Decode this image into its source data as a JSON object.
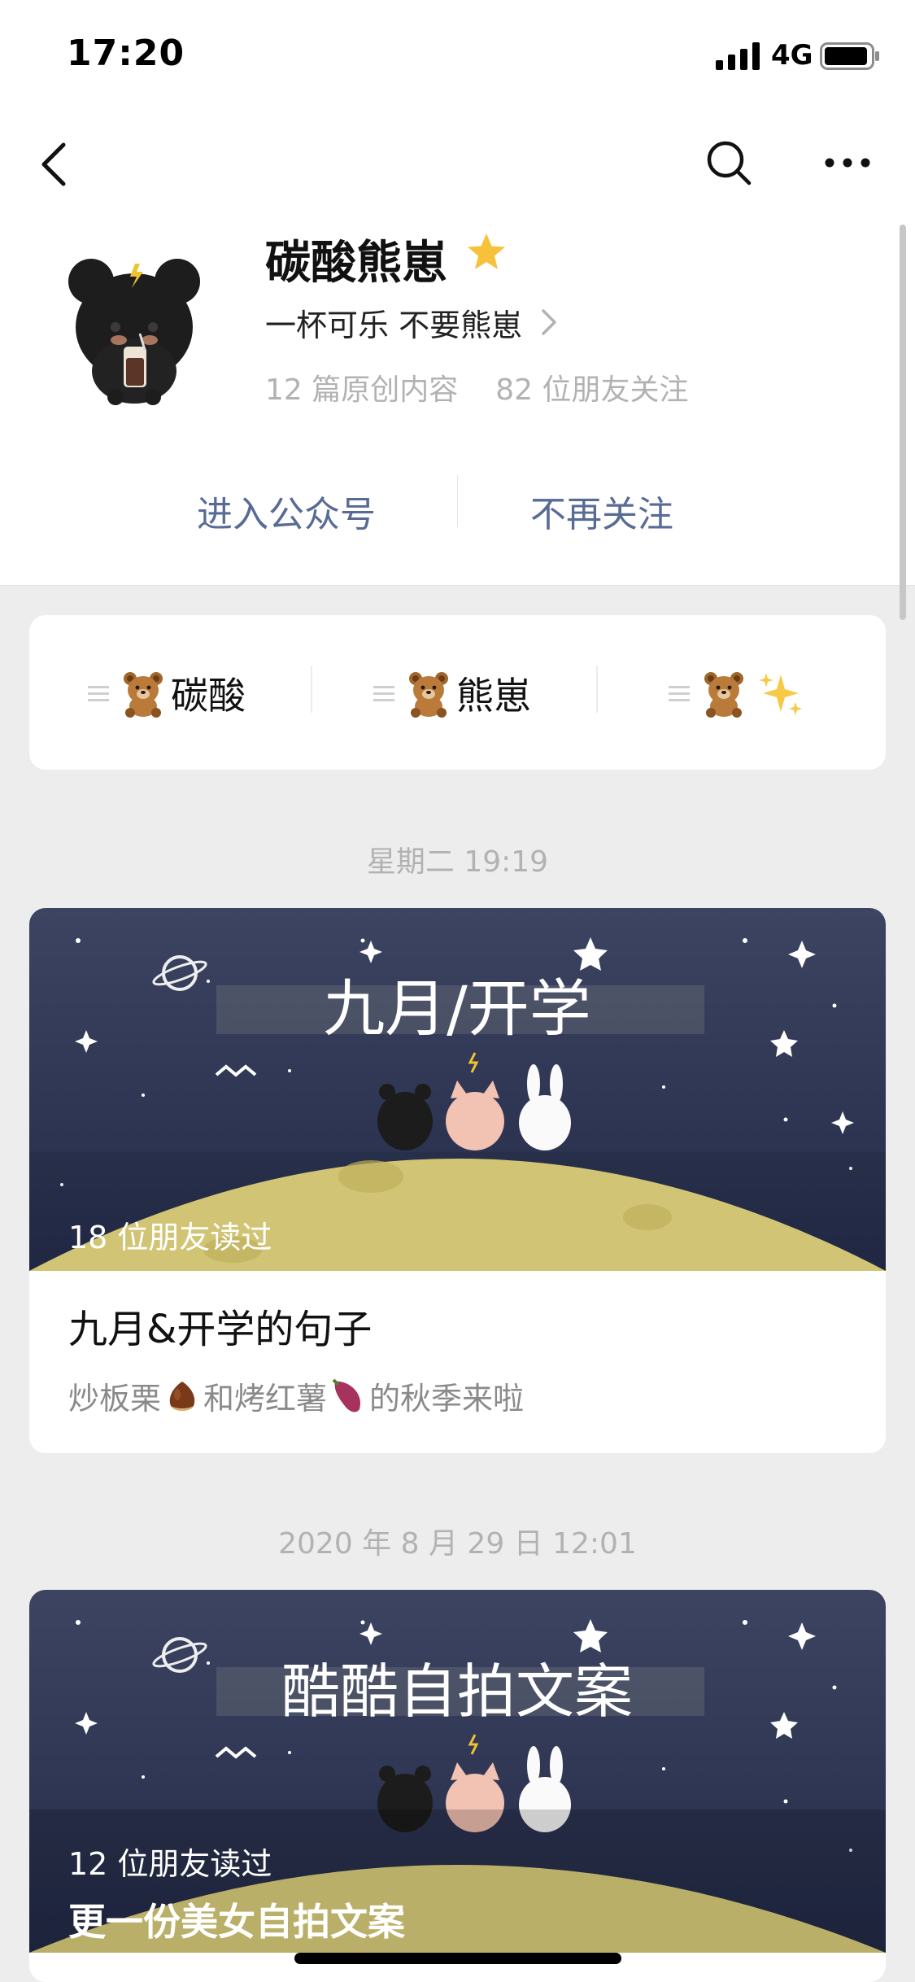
{
  "status_bar": {
    "time": "17:20",
    "network": "4G"
  },
  "nav": {
    "back": "back-icon",
    "search": "search-icon",
    "more": "more-icon"
  },
  "profile": {
    "name": "碳酸熊崽",
    "bio": "一杯可乐 不要熊崽",
    "stats": {
      "original_posts": "12 篇原创内容",
      "friends_following": "82 位朋友关注"
    },
    "actions": {
      "enter": "进入公众号",
      "unfollow": "不再关注"
    },
    "colors": {
      "link": "#576b95",
      "star": "#f7c23a"
    }
  },
  "menu": [
    {
      "label": "碳酸",
      "icon": "bear-icon"
    },
    {
      "label": "熊崽",
      "icon": "bear-icon"
    },
    {
      "label": "",
      "icon": "bear-icon",
      "extra_icon": "sparkle-icon"
    }
  ],
  "timeline": [
    {
      "date": "星期二 19:19",
      "cover_text": "九月/开学",
      "read_count": "18 位朋友读过",
      "title": "九月&开学的句子",
      "desc_parts": [
        "炒板栗",
        "和烤红薯",
        "的秋季来啦"
      ]
    },
    {
      "date": "2020 年 8 月 29 日 12:01",
      "cover_text": "酷酷自拍文案",
      "read_count": "12 位朋友读过",
      "title": "更一份美女自拍文案"
    }
  ]
}
